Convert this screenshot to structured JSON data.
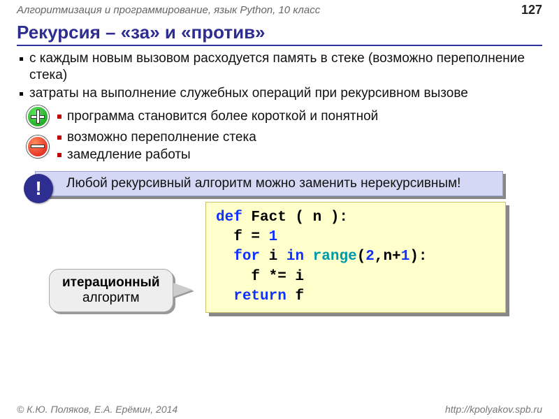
{
  "header": {
    "course": "Алгоритмизация и программирование, язык Python, 10 класс",
    "page": "127"
  },
  "title": "Рекурсия – «за» и «против»",
  "bullets": {
    "b1": "с каждым новым вызовом расходуется память в стеке (возможно переполнение стека)",
    "b2": "затраты на выполнение служебных операций при рекурсивном вызове"
  },
  "pro": "программа становится более короткой и понятной",
  "cons": {
    "c1": "возможно переполнение стека",
    "c2": "замедление работы"
  },
  "note": "Любой рекурсивный алгоритм можно заменить нерекурсивным!",
  "callout": {
    "l1": "итерационный",
    "l2": "алгоритм"
  },
  "code": {
    "def": "def",
    "name": " Fact ( n ):",
    "l2a": "  f = ",
    "l2b": "1",
    "for": "for",
    "in": "in",
    "range": "range",
    "l3a": " i ",
    "l3b": " ",
    "l3c": "(",
    "two": "2",
    "l3d": ",n+",
    "one2": "1",
    "l3e": "):",
    "l4": "    f *= i",
    "ret": "return",
    "l5": " f"
  },
  "footer": {
    "left": "© К.Ю. Поляков, Е.А. Ерёмин, 2014",
    "right": "http://kpolyakov.spb.ru"
  }
}
